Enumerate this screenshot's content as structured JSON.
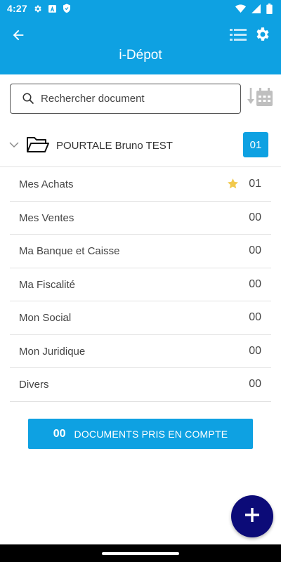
{
  "status_bar": {
    "time": "4:27",
    "icons": [
      "settings-gear-icon",
      "text-a-icon",
      "shield-icon",
      "wifi-icon",
      "signal-icon",
      "battery-icon"
    ]
  },
  "app_bar": {
    "title": "i-Dépot",
    "icons": [
      "back-arrow-icon",
      "list-icon",
      "gear-icon"
    ]
  },
  "search": {
    "placeholder": "Rechercher document",
    "value": ""
  },
  "sort": {
    "icon": "sort-by-date-icon"
  },
  "folder": {
    "name": "POURTALE Bruno TEST",
    "count": "01",
    "expanded": true
  },
  "categories": [
    {
      "label": "Mes Achats",
      "count": "01",
      "starred": true
    },
    {
      "label": "Mes Ventes",
      "count": "00",
      "starred": false
    },
    {
      "label": "Ma Banque et Caisse",
      "count": "00",
      "starred": false
    },
    {
      "label": "Ma Fiscalité",
      "count": "00",
      "starred": false
    },
    {
      "label": "Mon Social",
      "count": "00",
      "starred": false
    },
    {
      "label": "Mon Juridique",
      "count": "00",
      "starred": false
    },
    {
      "label": "Divers",
      "count": "00",
      "starred": false
    }
  ],
  "documents_button": {
    "count": "00",
    "label": "DOCUMENTS PRIS EN COMPTE"
  },
  "fab": {
    "icon": "plus-icon"
  },
  "colors": {
    "primary": "#0ea1e2",
    "fab": "#0c0b78",
    "star": "#f2c94c",
    "divider": "#e2e2e2"
  }
}
